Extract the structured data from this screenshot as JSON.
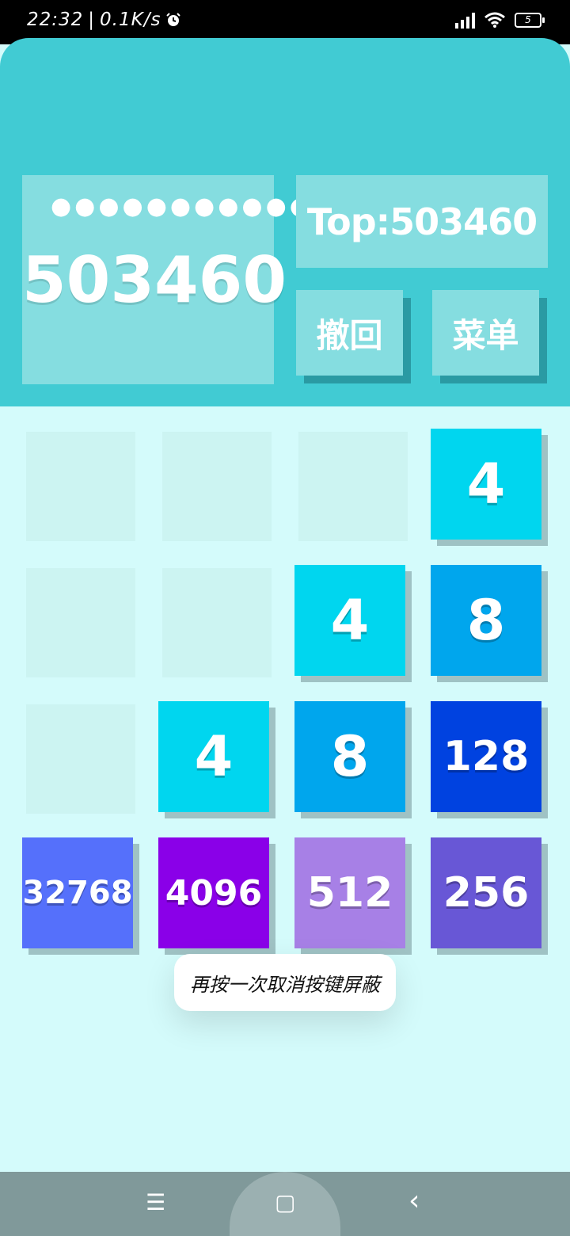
{
  "status_bar": {
    "time": "22:32",
    "separator": "|",
    "net_speed": "0.1K/s",
    "alarm_icon": "alarm-clock-icon",
    "battery": "5"
  },
  "header": {
    "dots": "●●●●●●●●●●●●",
    "score": "503460",
    "top_label": "Top:503460",
    "undo_label": "撤回",
    "menu_label": "菜单"
  },
  "board": {
    "tiles": [
      {
        "value": "4",
        "color": "#00d6ef"
      },
      {
        "value": "4",
        "color": "#00d6ef"
      },
      {
        "value": "8",
        "color": "#00a6ed"
      },
      {
        "value": "4",
        "color": "#00d6ef"
      },
      {
        "value": "8",
        "color": "#00a6ed"
      },
      {
        "value": "128",
        "color": "#0042e0"
      },
      {
        "value": "32768",
        "color": "#5570fb"
      },
      {
        "value": "4096",
        "color": "#8a00e8"
      },
      {
        "value": "512",
        "color": "#a780e6"
      },
      {
        "value": "256",
        "color": "#6857d6"
      }
    ]
  },
  "toast": {
    "message": "再按一次取消按键屏蔽"
  },
  "nav": {
    "menu_icon": "☰",
    "home_icon": "▢",
    "back_icon": "‹"
  }
}
